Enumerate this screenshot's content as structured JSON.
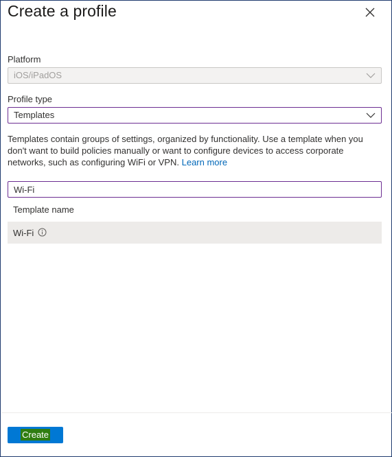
{
  "panel": {
    "title": "Create a profile",
    "close_icon": "close-icon"
  },
  "platform": {
    "label": "Platform",
    "value": "iOS/iPadOS",
    "disabled": true
  },
  "profile_type": {
    "label": "Profile type",
    "value": "Templates"
  },
  "description": {
    "text": "Templates contain groups of settings, organized by functionality. Use a template when you don't want to build policies manually or want to configure devices to access corporate networks, such as configuring WiFi or VPN.",
    "link_text": "Learn more"
  },
  "search": {
    "value": "Wi-Fi"
  },
  "template_table": {
    "column_header": "Template name",
    "rows": [
      {
        "name": "Wi-Fi",
        "icon": "info-icon",
        "selected": true
      }
    ]
  },
  "footer": {
    "create_label": "Create"
  },
  "colors": {
    "accent": "#0078d4",
    "focus_border": "#6b2c91",
    "link": "#0067b8",
    "selected_row": "#edebe9"
  }
}
